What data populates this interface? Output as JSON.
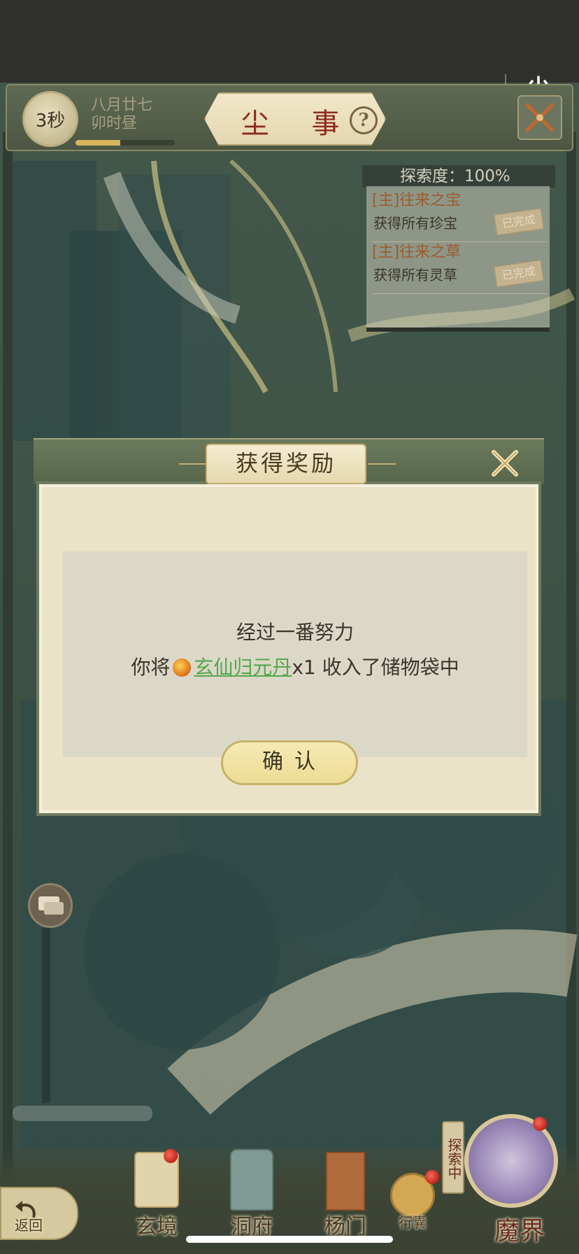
{
  "header": {
    "timer": "3秒",
    "game_date": "八月廿七",
    "game_time": "卯时昼",
    "title": "尘 事",
    "time_progress": 0.45
  },
  "quest_panel": {
    "exploration_label": "探索度：100%",
    "quests": [
      {
        "title": "[主]往来之宝",
        "desc": "获得所有珍宝",
        "status": "已完成"
      },
      {
        "title": "[主]往来之草",
        "desc": "获得所有灵草",
        "status": "已完成"
      }
    ]
  },
  "dialog": {
    "title": "获得奖励",
    "line1": "经过一番努力",
    "line2_prefix": "你将",
    "item_name": "玄仙归元丹",
    "line2_suffix": "x1 收入了储物袋中",
    "confirm_label": "确认"
  },
  "bottom_nav": {
    "back": "返回",
    "items": [
      "玄境",
      "洞府",
      "杨门",
      "行囊"
    ],
    "explore_tag": "探索中",
    "realm": "魔界"
  },
  "colors": {
    "title_red": "#8e2a1e",
    "item_link_green": "#55a84e",
    "quest_title_orange": "#9c5c2e"
  },
  "icons": {
    "menu": "more-dots-icon",
    "power": "power-icon",
    "help": "question-icon",
    "exit": "crossed-swords-icon",
    "close": "close-icon",
    "chat": "chat-bubble-icon",
    "pill": "pill-icon"
  }
}
